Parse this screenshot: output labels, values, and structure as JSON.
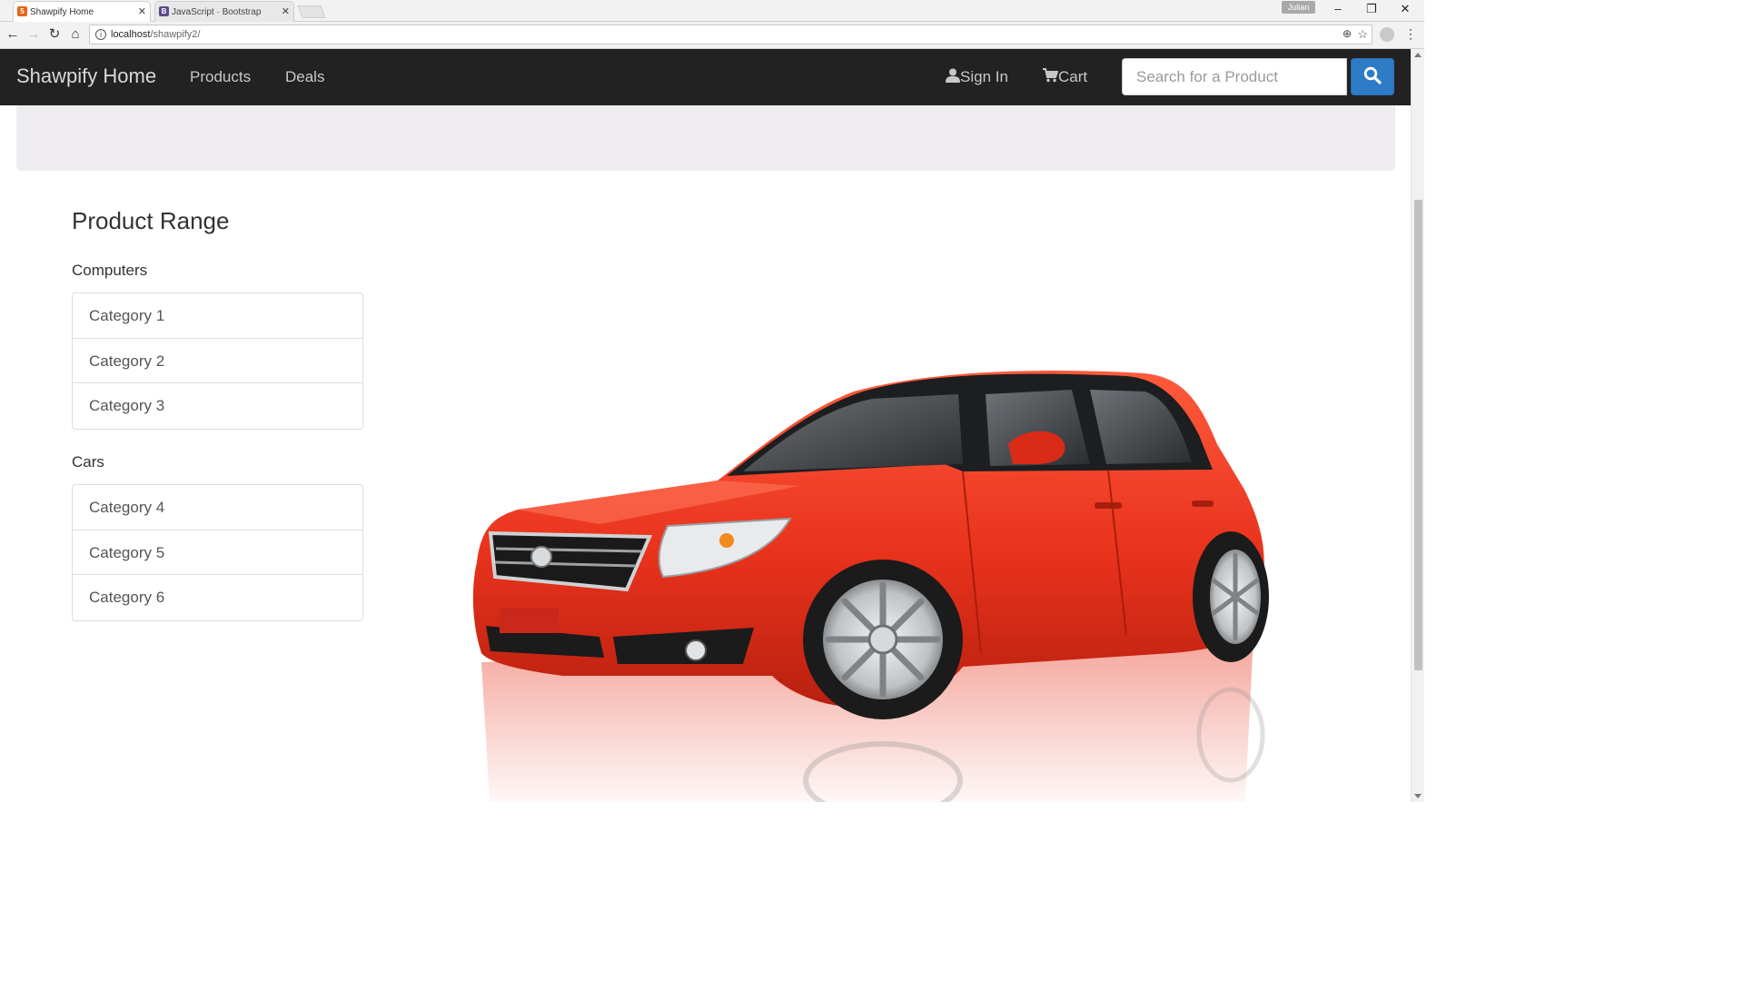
{
  "browser": {
    "tabs": [
      {
        "title": "Shawpify Home",
        "active": true,
        "favicon": "html5-icon"
      },
      {
        "title": "JavaScript · Bootstrap",
        "active": false,
        "favicon": "bootstrap-icon"
      }
    ],
    "url_host": "localhost",
    "url_path": "/shawpify2/",
    "user_badge": "Julian"
  },
  "navbar": {
    "brand": "Shawpify Home",
    "links": [
      "Products",
      "Deals"
    ],
    "sign_in": "Sign In",
    "cart": "Cart",
    "search_placeholder": "Search for a Product"
  },
  "main": {
    "section_title": "Product Range",
    "groups": [
      {
        "heading": "Computers",
        "items": [
          "Category 1",
          "Category 2",
          "Category 3"
        ]
      },
      {
        "heading": "Cars",
        "items": [
          "Category 4",
          "Category 5",
          "Category 6"
        ]
      }
    ]
  },
  "colors": {
    "navbar_bg": "#222222",
    "search_button": "#2e7bc6",
    "jumbotron_bg": "#efedf0",
    "car_body": "#e8321c"
  }
}
